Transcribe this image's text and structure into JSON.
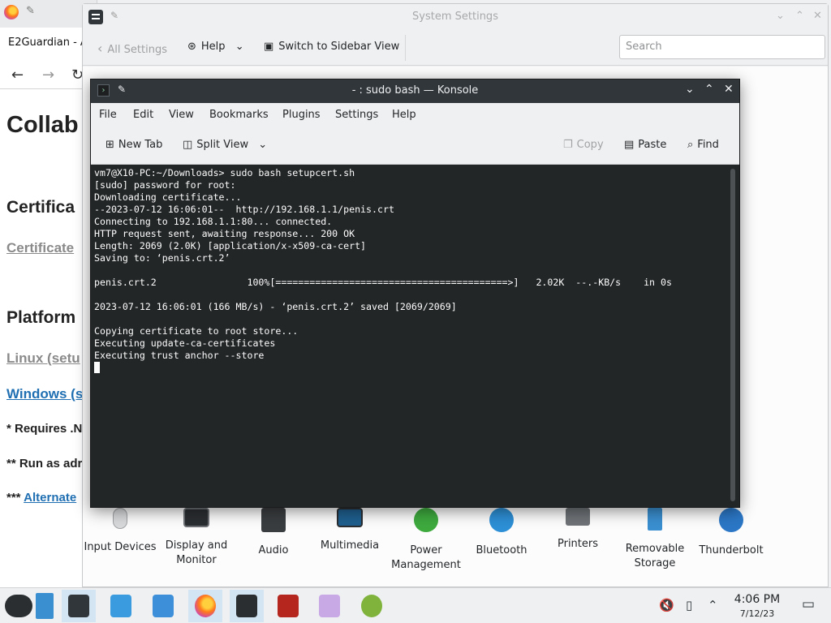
{
  "browser": {
    "tab_title": "E2Guardian - A",
    "heading": "Collab",
    "section1": "Certifica",
    "link1": "Certificate",
    "section2": "Platform",
    "link_linux": "Linux (setu",
    "link_windows": "Windows (s",
    "note1": "* Requires .N",
    "note2": "** Run as adr",
    "note3_prefix": "***",
    "note3_link": "Alternate"
  },
  "settings": {
    "title": "System Settings",
    "back_label": "All Settings",
    "help_label": "Help",
    "switch_label": "Switch to Sidebar View",
    "search_placeholder": "Search",
    "categories": [
      {
        "name": "Input Devices",
        "icon": "mouse-icon"
      },
      {
        "name": "Display and Monitor",
        "icon": "monitor-icon"
      },
      {
        "name": "Audio",
        "icon": "speaker-icon"
      },
      {
        "name": "Multimedia",
        "icon": "multimedia-icon"
      },
      {
        "name": "Power Management",
        "icon": "power-icon"
      },
      {
        "name": "Bluetooth",
        "icon": "bluetooth-icon"
      },
      {
        "name": "Printers",
        "icon": "printer-icon"
      },
      {
        "name": "Removable Storage",
        "icon": "usb-icon"
      },
      {
        "name": "Thunderbolt",
        "icon": "thunderbolt-icon"
      }
    ]
  },
  "konsole": {
    "title": "- : sudo bash — Konsole",
    "menu": [
      "File",
      "Edit",
      "View",
      "Bookmarks",
      "Plugins",
      "Settings",
      "Help"
    ],
    "toolbar": {
      "new_tab": "New Tab",
      "split_view": "Split View",
      "copy": "Copy",
      "paste": "Paste",
      "find": "Find"
    },
    "output": "vm7@X10-PC:~/Downloads> sudo bash setupcert.sh\n[sudo] password for root:\nDownloading certificate...\n--2023-07-12 16:06:01--  http://192.168.1.1/penis.crt\nConnecting to 192.168.1.1:80... connected.\nHTTP request sent, awaiting response... 200 OK\nLength: 2069 (2.0K) [application/x-x509-ca-cert]\nSaving to: ‘penis.crt.2’\n\npenis.crt.2                100%[=========================================>]   2.02K  --.-KB/s    in 0s\n\n2023-07-12 16:06:01 (166 MB/s) - ‘penis.crt.2’ saved [2069/2069]\n\nCopying certificate to root store...\nExecuting update-ca-certificates\nExecuting trust anchor --store\n"
  },
  "taskbar": {
    "time": "4:06 PM",
    "date": "7/12/23"
  }
}
